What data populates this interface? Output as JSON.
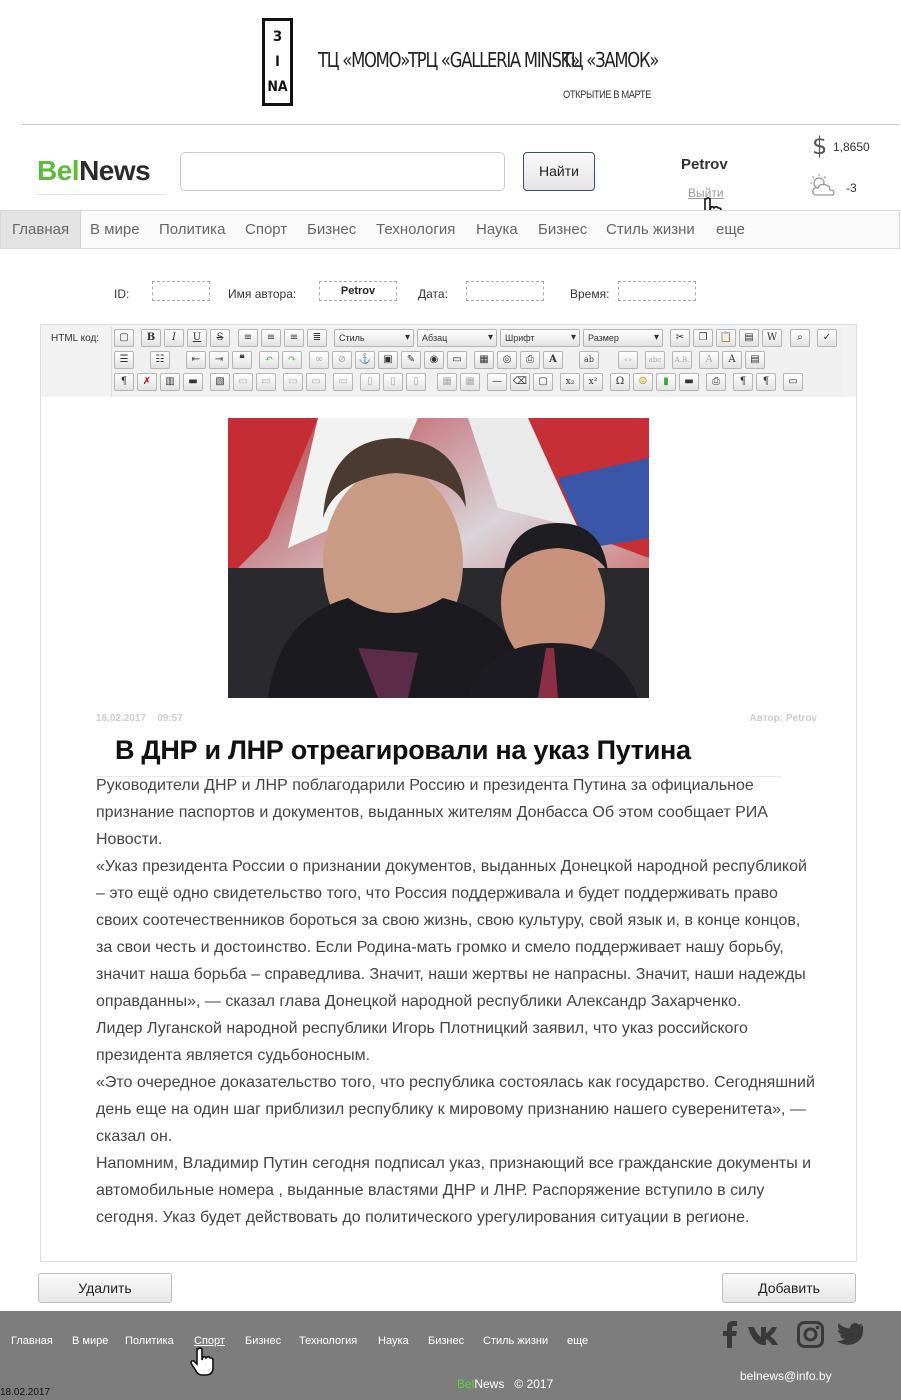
{
  "banner": {
    "logo_letters": [
      "З",
      "І",
      "NA"
    ],
    "malls": [
      "ТЦ «MOMO»",
      "ТРЦ «GALLERIA MINSK»",
      "ТЦ «ЗАМОК»"
    ],
    "mall_note": "ОТКРЫТИЕ В МАРТЕ"
  },
  "header": {
    "logo_part1": "Bel",
    "logo_part2": "News",
    "search_placeholder": "",
    "search_button": "Найти",
    "user": "Petrov",
    "logout": "Выйти",
    "currency_icon": "$",
    "rate": "1,8650",
    "weather_icon": "partly-cloudy-icon",
    "temperature": "-3"
  },
  "nav": {
    "items": [
      "Главная",
      "В мире",
      "Политика",
      "Спорт",
      "Бизнес",
      "Технология",
      "Наука",
      "Бизнес",
      "Стиль жизни",
      "еще"
    ],
    "active": "Главная"
  },
  "meta": {
    "id_label": "ID:",
    "id_value": "",
    "author_label": "Имя автора:",
    "author_value": "Petrov",
    "date_label": "Дата:",
    "date_value": "",
    "time_label": "Время:",
    "time_value": ""
  },
  "editor": {
    "html_label": "HTML код:",
    "selects": [
      "Стиль",
      "Абзац",
      "Шрифт",
      "Размер"
    ]
  },
  "article": {
    "date": "18.02.2017",
    "time": "09:57",
    "author": "Автор: Petrov",
    "title": "В ДНР и ЛНР отреагировали на указ Путина",
    "paragraphs": [
      "Руководители ДНР и ЛНР поблагодарили Россию и президента Путина за официальное признание паспортов и документов, выданных жителям Донбасса Об этом сообщает РИА Новости.",
      "«Указ президента России о признании документов, выданных Донецкой народной республикой – это ещё одно свидетельство того, что Россия поддерживала и будет поддерживать право своих соотечественников бороться за свою жизнь, свою культуру, свой язык и, в конце концов, за свои честь и достоинство. Если Родина-мать громко и смело поддерживает нашу борьбу, значит наша борьба – справедлива. Значит, наши жертвы не напрасны. Значит, наши надежды оправданны», — сказал глава Донецкой народной республики Александр Захарченко.",
      "Лидер Луганской народной республики Игорь Плотницкий заявил, что указ российского президента является судьбоносным.",
      "«Это очередное доказательство того, что республика состоялась как государство. Сегодняшний день еще на один шаг приблизил республику к мировому признанию нашего суверенитета», — сказал он.",
      "Напомним, Владимир Путин сегодня подписал указ, признающий все гражданские документы и автомобильные номера , выданные властями ДНР и ЛНР. Распоряжение вступило в силу сегодня. Указ будет действовать до политического урегулирования ситуации в регионе."
    ]
  },
  "actions": {
    "delete": "Удалить",
    "add": "Добавить"
  },
  "footer": {
    "nav": [
      "Главная",
      "В мире",
      "Политика",
      "Спорт",
      "Бизнес",
      "Технология",
      "Наука",
      "Бизнес",
      "Стиль жизни",
      "еще"
    ],
    "social_icons": [
      "facebook-icon",
      "vk-icon",
      "instagram-icon",
      "twitter-icon"
    ],
    "email": "belnews@info.by",
    "logo_part1": "Bel",
    "logo_part2": "News",
    "copyright": "© 2017",
    "date": "18.02.2017"
  },
  "colors": {
    "brand_green": "#5fba3e",
    "footer_bg": "#7d7d7d"
  }
}
